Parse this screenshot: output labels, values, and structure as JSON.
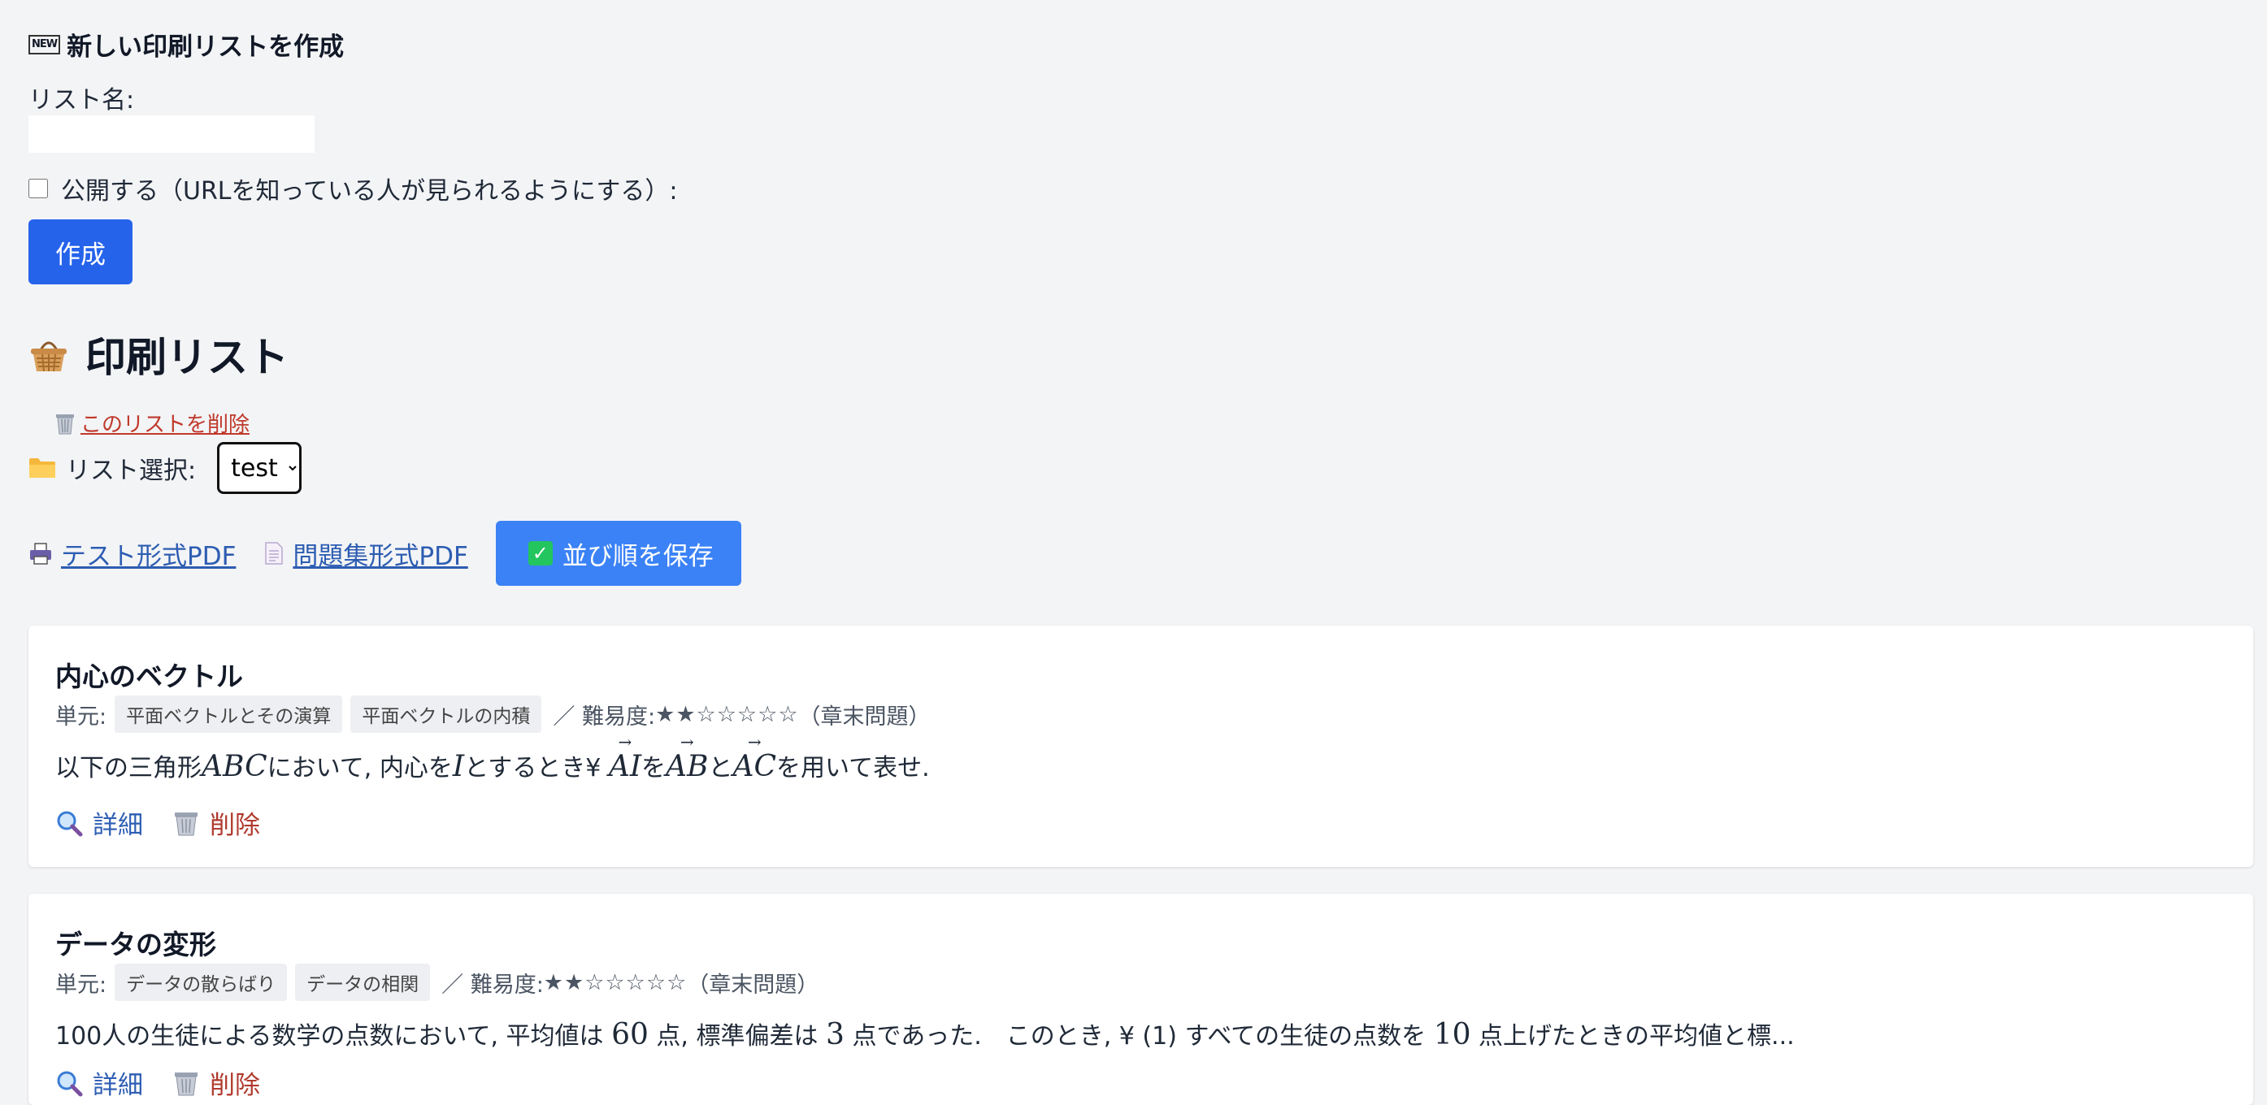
{
  "create_form": {
    "title": "新しい印刷リストを作成",
    "new_badge": "NEW",
    "name_label": "リスト名:",
    "name_value": "",
    "public_label": "公開する（URLを知っている人が見られるようにする）:",
    "create_button": "作成"
  },
  "print_list": {
    "title": "印刷リスト",
    "delete_list_link": "このリストを削除",
    "select_label": "リスト選択:",
    "selected_list": "test",
    "test_pdf_link": "テスト形式PDF",
    "workbook_pdf_link": "問題集形式PDF",
    "save_order_button": "並び順を保存"
  },
  "problems": [
    {
      "title": "内心のベクトル",
      "unit_label": "単元:",
      "tags": [
        "平面ベクトルとその演算",
        "平面ベクトルの内積"
      ],
      "difficulty_label": "／ 難易度:",
      "stars": "★★☆☆☆☆☆",
      "difficulty_rating": 2,
      "difficulty_max": 7,
      "category": "（章末問題）",
      "body": {
        "t1": "以下の三角形",
        "m1": "ABC",
        "t2": "において, 内心を",
        "m2": "I",
        "t3": "とするとき¥ ",
        "v1": "AI",
        "t4": "を",
        "v2": "AB",
        "t5": "と",
        "v3": "AC",
        "t6": "を用いて表せ."
      },
      "detail_link": "詳細",
      "delete_link": "削除"
    },
    {
      "title": "データの変形",
      "unit_label": "単元:",
      "tags": [
        "データの散らばり",
        "データの相関"
      ],
      "difficulty_label": "／ 難易度:",
      "stars": "★★☆☆☆☆☆",
      "difficulty_rating": 2,
      "difficulty_max": 7,
      "category": "（章末問題）",
      "body": {
        "t1": "100人の生徒による数学の点数において, 平均値は ",
        "n1": "60",
        "t2": " 点, 標準偏差は ",
        "n2": "3",
        "t3": " 点であった.　このとき, ¥ (1) すべての生徒の点数を ",
        "n3": "10",
        "t4": " 点上げたときの平均値と標..."
      },
      "detail_link": "詳細",
      "delete_link": "削除"
    }
  ],
  "colors": {
    "primary_button": "#2563eb",
    "save_button": "#3b82f6",
    "link_blue": "#2d5db2",
    "delete_red": "#b03a2e",
    "page_bg": "#f3f4f6"
  },
  "icons": [
    "new-icon",
    "basket-icon",
    "wastebasket-icon",
    "folder-icon",
    "printer-icon",
    "document-icon",
    "check-icon",
    "magnifier-icon"
  ]
}
